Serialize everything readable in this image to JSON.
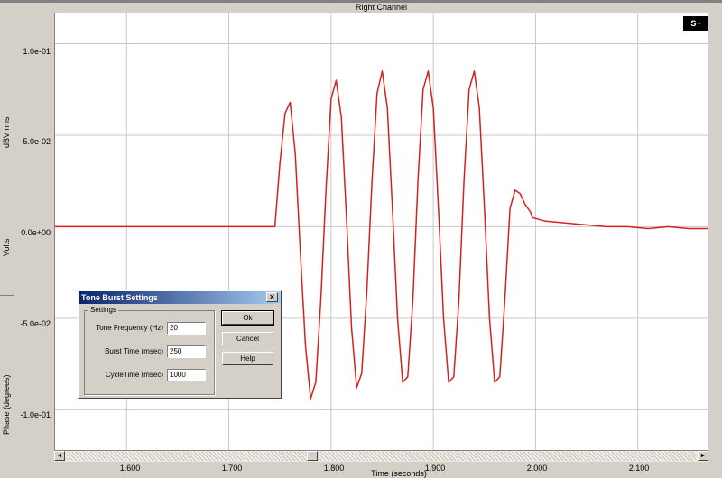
{
  "window": {
    "title": "Right Channel"
  },
  "left_panel": {
    "label_top": "dBV rms",
    "label_mid": "Volts",
    "label_bottom": "Phase (degrees)"
  },
  "chart_data": {
    "type": "line",
    "title": "Right Channel",
    "xlabel": "Time (seconds)",
    "ylabel": "Volts",
    "xlim": [
      1.53,
      2.17
    ],
    "ylim": [
      -0.122,
      0.117
    ],
    "x_ticks": [
      "1.600",
      "1.700",
      "1.800",
      "1.900",
      "2.000",
      "2.100"
    ],
    "y_ticks": [
      "1.0e-01",
      "5.0e-02",
      "0.0e+00",
      "-5.0e-02",
      "-1.0e-01"
    ],
    "line_color": "#d62020",
    "grid": true,
    "series": [
      {
        "x": [
          1.53,
          1.745,
          1.75,
          1.755,
          1.76,
          1.765,
          1.77,
          1.775,
          1.78,
          1.785,
          1.79,
          1.795,
          1.8,
          1.805,
          1.81,
          1.815,
          1.82,
          1.825,
          1.83,
          1.835,
          1.84,
          1.845,
          1.85,
          1.855,
          1.86,
          1.865,
          1.87,
          1.875,
          1.88,
          1.885,
          1.89,
          1.895,
          1.9,
          1.905,
          1.91,
          1.915,
          1.92,
          1.925,
          1.93,
          1.935,
          1.94,
          1.945,
          1.95,
          1.955,
          1.96,
          1.965,
          1.97,
          1.975,
          1.98,
          1.985,
          1.99,
          1.995,
          1.997,
          2.01,
          2.03,
          2.05,
          2.07,
          2.09,
          2.11,
          2.13,
          2.15,
          2.17
        ],
        "y": [
          0.0,
          0.0,
          0.035,
          0.062,
          0.068,
          0.04,
          -0.015,
          -0.065,
          -0.094,
          -0.085,
          -0.04,
          0.02,
          0.07,
          0.08,
          0.06,
          0.005,
          -0.055,
          -0.088,
          -0.08,
          -0.035,
          0.025,
          0.073,
          0.085,
          0.065,
          0.01,
          -0.05,
          -0.085,
          -0.082,
          -0.04,
          0.025,
          0.075,
          0.085,
          0.065,
          0.01,
          -0.05,
          -0.085,
          -0.082,
          -0.04,
          0.025,
          0.075,
          0.085,
          0.065,
          0.01,
          -0.05,
          -0.085,
          -0.082,
          -0.04,
          0.01,
          0.02,
          0.018,
          0.012,
          0.008,
          0.005,
          0.003,
          0.002,
          0.001,
          0.0,
          0.0,
          -0.001,
          0.0,
          -0.001,
          -0.001
        ]
      }
    ]
  },
  "corner_icon": "signal-type-icon",
  "dialog": {
    "title": "Tone Burst Settings",
    "close": "×",
    "group": "Settings",
    "fields": [
      {
        "label": "Tone Frequency (Hz)",
        "value": "20"
      },
      {
        "label": "Burst Time (msec)",
        "value": "250"
      },
      {
        "label": "CycleTime (msec)",
        "value": "1000"
      }
    ],
    "buttons": {
      "ok": "Ok",
      "cancel": "Cancel",
      "help": "Help"
    }
  },
  "scrollbar": {
    "left_arrow": "◄",
    "right_arrow": "►"
  }
}
